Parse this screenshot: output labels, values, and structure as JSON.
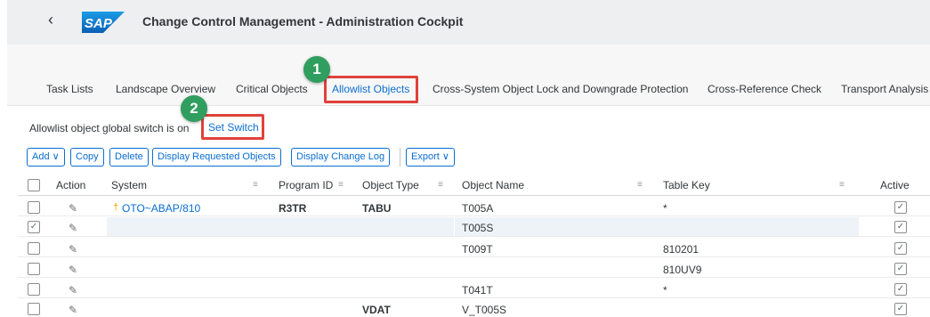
{
  "shell": {
    "title": "Change Control Management - Administration Cockpit",
    "logo_text": "SAP"
  },
  "tabs": [
    {
      "label": "Task Lists"
    },
    {
      "label": "Landscape Overview"
    },
    {
      "label": "Critical Objects"
    },
    {
      "label": "Allowlist Objects",
      "selected": true
    },
    {
      "label": "Cross-System Object Lock and Downgrade Protection"
    },
    {
      "label": "Cross-Reference Check"
    },
    {
      "label": "Transport Analysis"
    }
  ],
  "switch": {
    "status_text": "Allowlist object global switch is on",
    "set_label": "Set Switch"
  },
  "callouts": [
    "1",
    "2"
  ],
  "toolbar": {
    "add": "Add",
    "copy": "Copy",
    "delete": "Delete",
    "display_requested": "Display Requested Objects",
    "display_change_log": "Display Change Log",
    "export": "Export"
  },
  "table": {
    "headers": [
      "Action",
      "System",
      "Program ID",
      "Object Type",
      "Object Name",
      "Table Key",
      "Active"
    ],
    "rows": [
      {
        "selected": false,
        "system": "OTO~ABAP/810",
        "program_id": "R3TR",
        "object_type": "TABU",
        "object_name": "T005A",
        "table_key": "*",
        "active": true
      },
      {
        "selected": true,
        "system": "",
        "program_id": "",
        "object_type": "",
        "object_name": "T005S",
        "table_key": "",
        "active": true
      },
      {
        "selected": false,
        "system": "",
        "program_id": "",
        "object_type": "",
        "object_name": "T009T",
        "table_key": "810201",
        "active": true
      },
      {
        "selected": false,
        "system": "",
        "program_id": "",
        "object_type": "",
        "object_name": "",
        "table_key": "810UV9",
        "active": true
      },
      {
        "selected": false,
        "system": "",
        "program_id": "",
        "object_type": "",
        "object_name": "T041T",
        "table_key": "*",
        "active": true
      },
      {
        "selected": false,
        "system": "",
        "program_id": "",
        "object_type": "VDAT",
        "object_name": "V_T005S",
        "table_key": "",
        "active": true
      }
    ]
  },
  "colors": {
    "accent": "#0a6ed1",
    "highlight": "#e0423b",
    "badge": "#2f9e5f"
  }
}
